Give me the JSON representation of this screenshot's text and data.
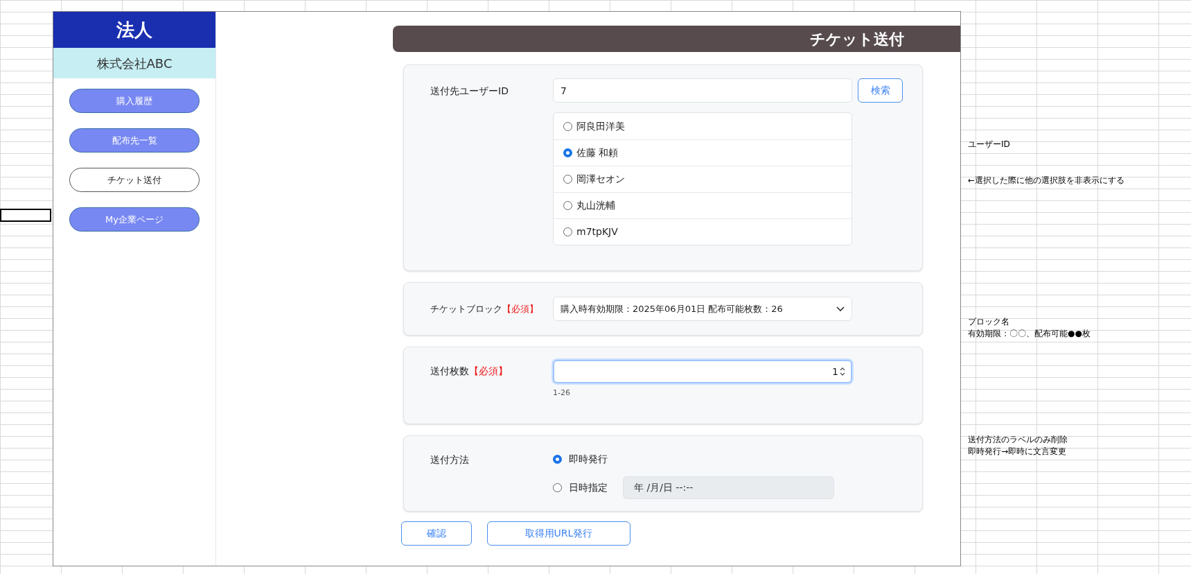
{
  "sidebar": {
    "title": "法人",
    "company": "株式会社ABC",
    "nav": [
      {
        "label": "購入履歴",
        "selected": false
      },
      {
        "label": "配布先一覧",
        "selected": false
      },
      {
        "label": "チケット送付",
        "selected": true
      },
      {
        "label": "My企業ページ",
        "selected": false
      }
    ]
  },
  "page_title": "チケット送付",
  "recipient": {
    "label": "送付先ユーザーID",
    "value": "7",
    "search_button": "検索",
    "users": [
      {
        "name": "阿良田洋美",
        "selected": false
      },
      {
        "name": "佐藤 和頼",
        "selected": true
      },
      {
        "name": "岡澤セオン",
        "selected": false
      },
      {
        "name": "丸山洸輔",
        "selected": false
      },
      {
        "name": "m7tpKJV",
        "selected": false
      }
    ]
  },
  "ticket_block": {
    "label": "チケットブロック",
    "required": "【必須】",
    "value": "購入時有効期限：2025年06月01日 配布可能枚数：26"
  },
  "quantity": {
    "label": "送付枚数",
    "required": "【必須】",
    "value": "1",
    "hint": "1-26",
    "focused": true
  },
  "method": {
    "label": "送付方法",
    "options": [
      {
        "label": "即時発行",
        "selected": true
      },
      {
        "label": "日時指定",
        "selected": false
      }
    ],
    "datetime_placeholder": "年 /月/日 --:--",
    "datetime_disabled": true
  },
  "buttons": [
    "確認",
    "取得用URL発行"
  ],
  "notes": [
    {
      "lines": [
        "ユーザーID"
      ]
    },
    {
      "lines": [
        "←選択した際に他の選択肢を非表示にする"
      ]
    },
    {
      "lines": [
        "ブロック名",
        "有効期限：〇〇、配布可能●●枚"
      ]
    },
    {
      "lines": [
        "送付方法のラベルのみ削除",
        "即時発行→即時に文言変更"
      ]
    }
  ]
}
